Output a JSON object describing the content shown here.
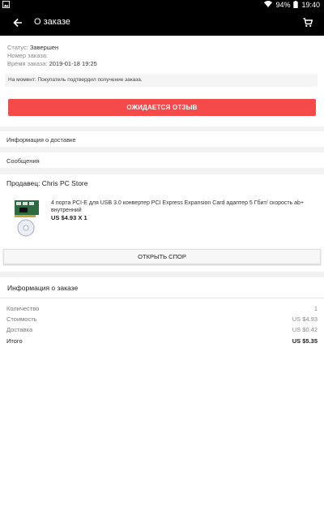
{
  "status_bar": {
    "battery": "94%",
    "time": "19:40"
  },
  "app_bar": {
    "title": "О заказе"
  },
  "order_status": {
    "status_label": "Статус:",
    "status_value": "Завершен",
    "order_number_label": "Номер заказа:",
    "order_number_value": "",
    "time_label": "Время заказа:",
    "time_value": "2019-01-18 19:25",
    "notice": "На момент: Покупатель подтвердил получение заказа.",
    "review_button": "ОЖИДАЕТСЯ ОТЗЫВ"
  },
  "delivery_info": {
    "label": "Информация о доставке"
  },
  "messages": {
    "label": "Сообщения"
  },
  "seller": {
    "label": "Продавец: Chris PC Store",
    "product_title": "4 порта PCI-E для USB 3.0 конвертер PCI Express Expansion Card адаптер 5 Гбит/ скорость ab+ внутренний",
    "product_price": "US $4.93 X 1",
    "dispute_button": "ОТКРЫТЬ СПОР"
  },
  "order_info": {
    "title": "Информация о заказе",
    "rows": [
      {
        "label": "Количество",
        "value": "1"
      },
      {
        "label": "Стоимость",
        "value": "US $4.93"
      },
      {
        "label": "Доставка",
        "value": "US $0.42"
      },
      {
        "label": "Итого",
        "value": "US $5.35"
      }
    ]
  },
  "colors": {
    "accent": "#f44a4a",
    "app_bar": "#000000"
  },
  "icons": [
    "photo-icon",
    "wifi-icon",
    "battery-icon",
    "back-arrow-icon",
    "cart-icon"
  ]
}
